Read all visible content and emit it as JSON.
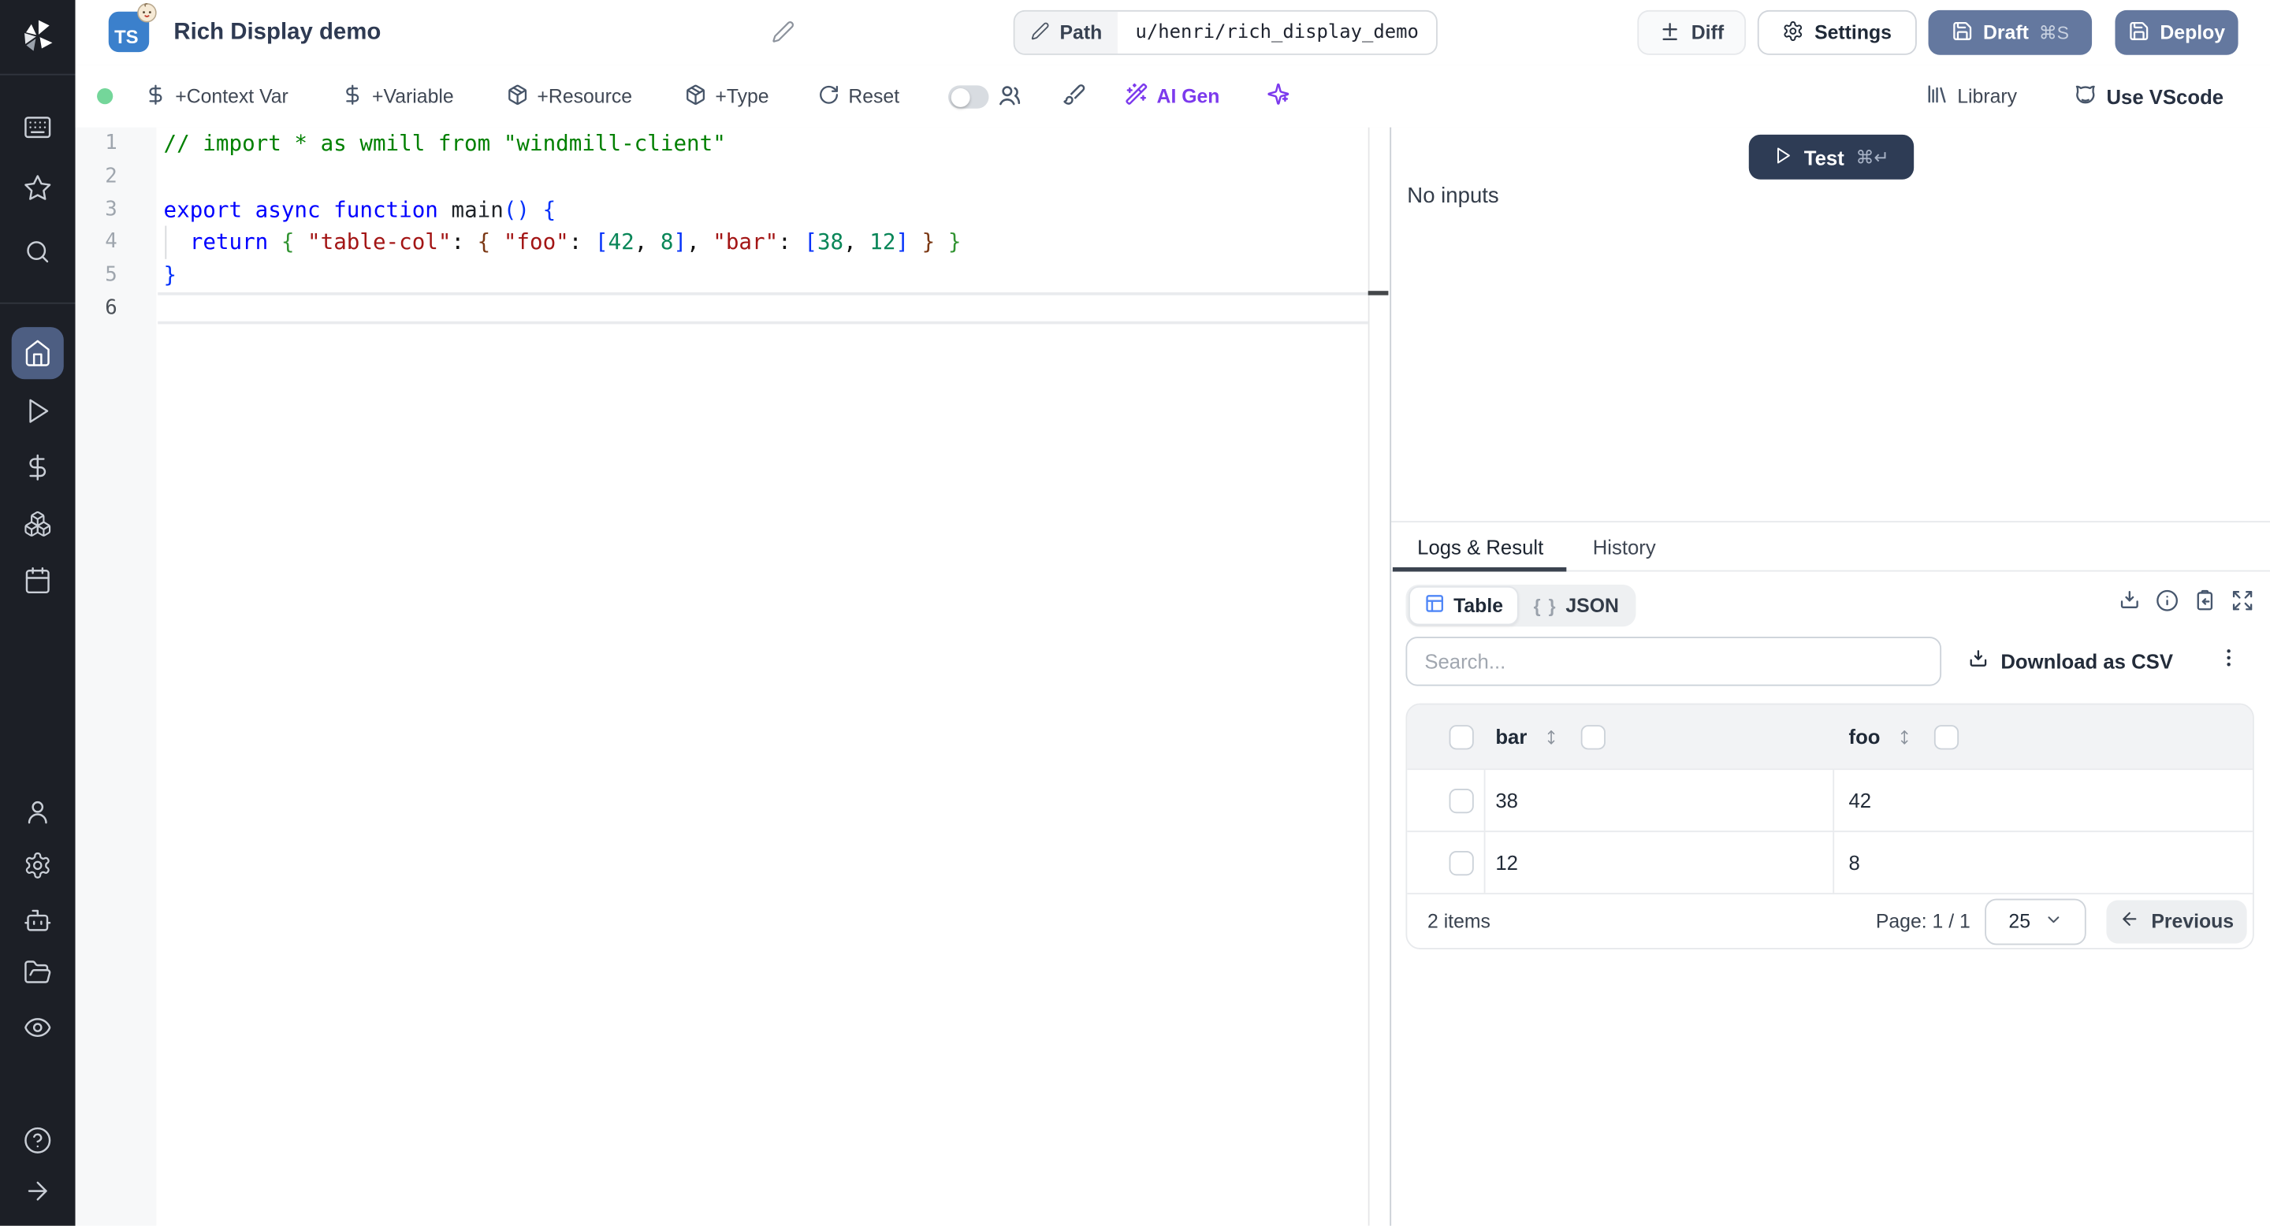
{
  "colors": {
    "accent_slate": "#64789f",
    "test_navy": "#2e3c55",
    "ai_purple": "#7c3aed",
    "ts_blue": "#3b80cc",
    "ok_green": "#74d69a",
    "active_nav": "#4d5e82"
  },
  "header": {
    "badge": "TS",
    "title": "Rich Display demo",
    "path_label": "Path",
    "path_value": "u/henri/rich_display_demo",
    "diff": "Diff",
    "settings": "Settings",
    "draft": "Draft",
    "draft_shortcut": "⌘S",
    "deploy": "Deploy"
  },
  "toolbar": {
    "context_var": "+Context Var",
    "variable": "+Variable",
    "resource": "+Resource",
    "type": "+Type",
    "reset": "Reset",
    "ai_gen": "AI Gen",
    "library": "Library",
    "vscode": "Use VScode"
  },
  "editor": {
    "lines": [
      {
        "num": "1",
        "tokens": [
          {
            "t": "// import * as wmill from \"windmill-client\"",
            "c": "comment"
          }
        ]
      },
      {
        "num": "2",
        "tokens": []
      },
      {
        "num": "3",
        "tokens": [
          {
            "t": "export async function",
            "c": "kw"
          },
          {
            "t": " ",
            "c": "pl"
          },
          {
            "t": "main",
            "c": "fn"
          },
          {
            "t": "() {",
            "c": "b1"
          }
        ]
      },
      {
        "num": "4",
        "tokens": [
          {
            "t": "  ",
            "c": "pl"
          },
          {
            "t": "return",
            "c": "kw"
          },
          {
            "t": " ",
            "c": "pl"
          },
          {
            "t": "{",
            "c": "b2"
          },
          {
            "t": " ",
            "c": "pl"
          },
          {
            "t": "\"table-col\"",
            "c": "str"
          },
          {
            "t": ": ",
            "c": "pl"
          },
          {
            "t": "{",
            "c": "b3"
          },
          {
            "t": " ",
            "c": "pl"
          },
          {
            "t": "\"foo\"",
            "c": "str"
          },
          {
            "t": ": ",
            "c": "pl"
          },
          {
            "t": "[",
            "c": "b1"
          },
          {
            "t": "42",
            "c": "num"
          },
          {
            "t": ", ",
            "c": "pl"
          },
          {
            "t": "8",
            "c": "num"
          },
          {
            "t": "]",
            "c": "b1"
          },
          {
            "t": ", ",
            "c": "pl"
          },
          {
            "t": "\"bar\"",
            "c": "str"
          },
          {
            "t": ": ",
            "c": "pl"
          },
          {
            "t": "[",
            "c": "b1"
          },
          {
            "t": "38",
            "c": "num"
          },
          {
            "t": ", ",
            "c": "pl"
          },
          {
            "t": "12",
            "c": "num"
          },
          {
            "t": "]",
            "c": "b1"
          },
          {
            "t": " ",
            "c": "pl"
          },
          {
            "t": "}",
            "c": "b3"
          },
          {
            "t": " ",
            "c": "pl"
          },
          {
            "t": "}",
            "c": "b2"
          }
        ]
      },
      {
        "num": "5",
        "tokens": [
          {
            "t": "}",
            "c": "b1"
          }
        ]
      },
      {
        "num": "6",
        "tokens": [],
        "current": true
      }
    ]
  },
  "run_panel": {
    "test": "Test",
    "test_shortcut": "⌘↵",
    "no_inputs": "No inputs",
    "tab_logs": "Logs & Result",
    "tab_history": "History",
    "view_table": "Table",
    "view_json": "JSON",
    "json_glyph": "{ }",
    "search_placeholder": "Search...",
    "download_csv": "Download as CSV"
  },
  "result_table": {
    "columns": [
      "bar",
      "foo"
    ],
    "rows": [
      [
        "38",
        "42"
      ],
      [
        "12",
        "8"
      ]
    ],
    "items_count": "2 items",
    "page_label": "Page: 1 / 1",
    "page_size": "25",
    "previous": "Previous"
  },
  "icons": [
    "windmill-logo",
    "keyboard-icon",
    "star-icon",
    "search-icon",
    "home-icon",
    "play-icon",
    "dollar-icon",
    "boxes-icon",
    "calendar-icon",
    "user-icon",
    "gear-icon",
    "robot-icon",
    "folder-icon",
    "eye-icon",
    "help-icon",
    "arrow-right-icon",
    "pencil-icon",
    "diff-icon",
    "save-icon",
    "toggle",
    "users-icon",
    "brush-icon",
    "wand-icon",
    "sparkles-icon",
    "library-icon",
    "vscode-icon",
    "table-icon",
    "json-icon",
    "download-icon",
    "info-icon",
    "clipboard-icon",
    "expand-icon",
    "kebab-icon",
    "sort-icon",
    "chevron-down-icon",
    "arrow-left-icon"
  ]
}
